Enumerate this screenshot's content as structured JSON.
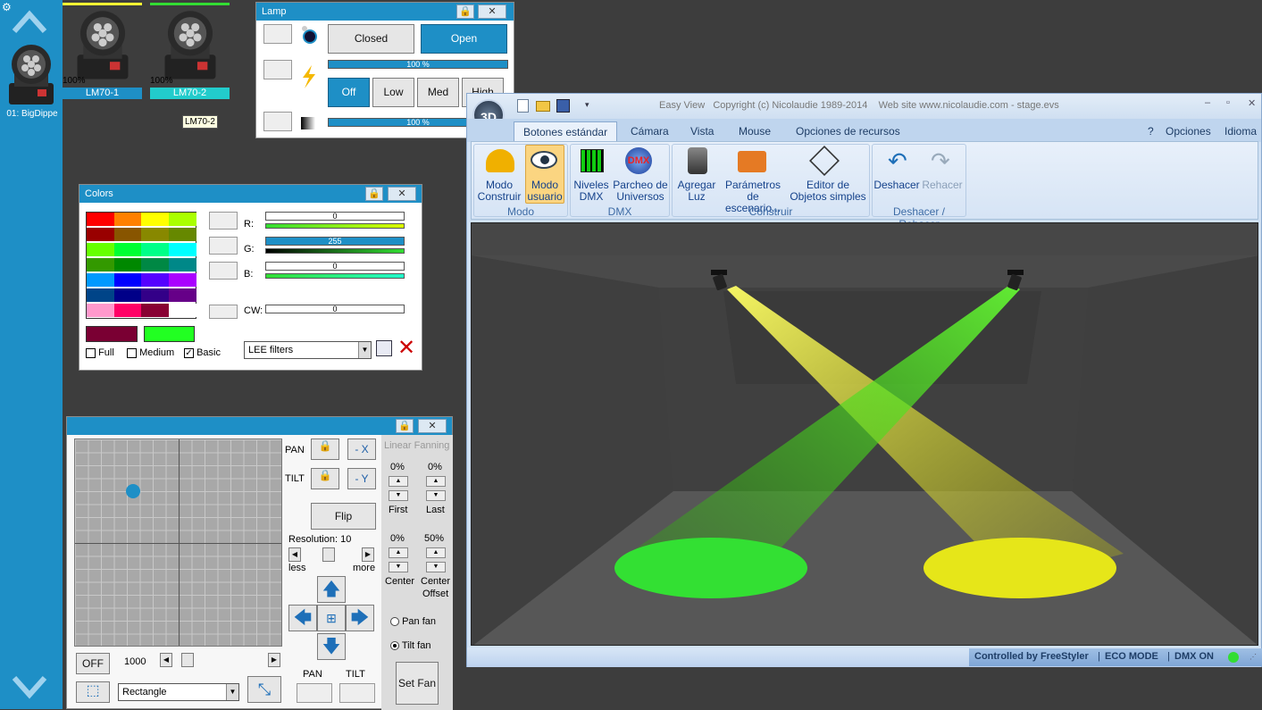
{
  "sidebar": {
    "fixture_label": "01: BigDippe",
    "up_icon": "chevron-up-icon",
    "down_icon": "chevron-down-icon",
    "settings_icon": "gear-icon"
  },
  "fixtures": [
    {
      "pct": "100%",
      "name": "LM70-1",
      "bar_color": "#ffff33",
      "label_color": "#1e8fc6"
    },
    {
      "pct": "100%",
      "name": "LM70-2",
      "bar_color": "#33dd33",
      "label_color": "#22cccc"
    }
  ],
  "tooltip": "LM70-2",
  "lamp": {
    "title": "Lamp",
    "closed_label": "Closed",
    "open_label": "Open",
    "dimmer_pct": "100 %",
    "off_label": "Off",
    "low_label": "Low",
    "med_label": "Med",
    "high_label": "High",
    "strobe_pct": "100 %"
  },
  "colors": {
    "title": "Colors",
    "swatches": [
      "#ff0000",
      "#ff8000",
      "#ffff00",
      "#aaff00",
      "#990000",
      "#885500",
      "#888800",
      "#668800",
      "#66ff00",
      "#00ff33",
      "#00ff88",
      "#00ffff",
      "#339900",
      "#008800",
      "#008844",
      "#008888",
      "#0099ff",
      "#0000ff",
      "#5500ff",
      "#aa00ff",
      "#004488",
      "#000088",
      "#330088",
      "#660088",
      "#ff99cc",
      "#ff0066",
      "#880033",
      "#ffffff"
    ],
    "current_a": "#7a0033",
    "current_b": "#22ff22",
    "r_label": "R:",
    "r_value": "0",
    "g_label": "G:",
    "g_value": "255",
    "b_label": "B:",
    "b_value": "0",
    "cw_label": "CW:",
    "cw_value": "0",
    "full_label": "Full",
    "medium_label": "Medium",
    "basic_label": "Basic",
    "filter_select": "LEE filters"
  },
  "pantilt": {
    "pan_label": "PAN",
    "tilt_label": "TILT",
    "minus_x": "- X",
    "minus_y": "- Y",
    "flip_label": "Flip",
    "resolution_label": "Resolution: 10",
    "less_label": "less",
    "more_label": "more",
    "off_label": "OFF",
    "speed_value": "1000",
    "shape_select": "Rectangle",
    "pan_bottom": "PAN",
    "tilt_bottom": "TILT",
    "dot_x": 0.28,
    "dot_y": 0.25
  },
  "fanning": {
    "title": "Linear Fanning",
    "first_pct": "0%",
    "last_pct": "0%",
    "first_label": "First",
    "last_label": "Last",
    "center_pct": "0%",
    "offset_pct": "50%",
    "center_label": "Center",
    "center_offset_label_1": "Center",
    "center_offset_label_2": "Offset",
    "pan_fan_label": "Pan fan",
    "tilt_fan_label": "Tilt fan",
    "set_fan_label": "Set Fan"
  },
  "easyview": {
    "title": "Easy View   Copyright (c) Nicolaudie 1989-2014    Web site www.nicolaudie.com - stage.evs",
    "logo": "3D",
    "tabs": [
      "Botones estándar",
      "Cámara",
      "Vista",
      "Mouse",
      "Opciones de recursos"
    ],
    "right_menu": [
      "?",
      "Opciones",
      "Idioma"
    ],
    "buttons": {
      "modo_construir_1": "Modo",
      "modo_construir_2": "Construir",
      "modo_usuario_1": "Modo",
      "modo_usuario_2": "usuario",
      "niveles_1": "Niveles",
      "niveles_2": "DMX",
      "parcheo_1": "Parcheo de",
      "parcheo_2": "Universos",
      "agregar_1": "Agregar",
      "agregar_2": "Luz",
      "parametros_1": "Parámetros de",
      "parametros_2": "escenario...",
      "editor_1": "Editor de",
      "editor_2": "Objetos simples",
      "deshacer": "Deshacer",
      "rehacer": "Rehacer"
    },
    "groups": {
      "modo": "Modo",
      "dmx": "DMX",
      "construir": "Construir",
      "deshacer": "Deshacer / Rehacer"
    },
    "status": {
      "controlled": "Controlled by FreeStyler",
      "eco": "ECO MODE",
      "dmx": "DMX ON"
    }
  }
}
